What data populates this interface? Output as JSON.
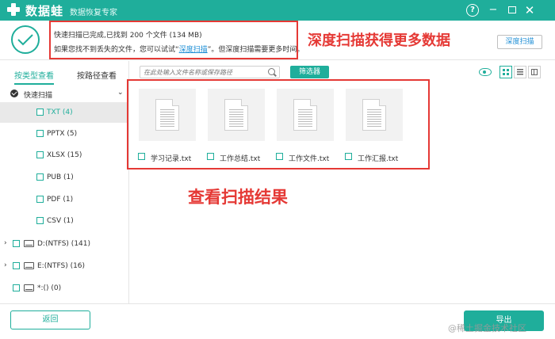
{
  "app": {
    "name": "数据蛙",
    "subtitle": "数据恢复专家",
    "help_label": "?",
    "min_label": "−",
    "close_label": "✕"
  },
  "scan_info": {
    "line1": "快速扫描已完成,已找到 200 个文件 (134 MB)",
    "line2_prefix": "如果您找不到丢失的文件，您可以试试",
    "line2_link": "深度扫描",
    "line2_suffix": "。但深度扫描需要更多时间。",
    "deep_scan_button": "深度扫描"
  },
  "sidebar": {
    "tabs": [
      {
        "label": "按类型查看",
        "active": true
      },
      {
        "label": "按路径查看",
        "active": false
      }
    ],
    "quick_scan_label": "快速扫描",
    "file_types": [
      {
        "label": "TXT (4)",
        "selected": true
      },
      {
        "label": "PPTX (5)",
        "selected": false
      },
      {
        "label": "XLSX (15)",
        "selected": false
      },
      {
        "label": "PUB (1)",
        "selected": false
      },
      {
        "label": "PDF (1)",
        "selected": false
      },
      {
        "label": "CSV (1)",
        "selected": false
      }
    ],
    "drives": [
      {
        "label": "D:(NTFS) (141)"
      },
      {
        "label": "E:(NTFS) (16)"
      },
      {
        "label": "*:() (0)"
      }
    ]
  },
  "toolbar": {
    "search_placeholder": "在此处输入文件名称或保存路径",
    "filter_button": "筛选器"
  },
  "files": [
    {
      "name": "学习记录.txt"
    },
    {
      "name": "工作总结.txt"
    },
    {
      "name": "工作文件.txt"
    },
    {
      "name": "工作汇报.txt"
    }
  ],
  "annotations": {
    "deep_scan_note": "深度扫描获得更多数据",
    "view_results_note": "查看扫描结果",
    "color": "#e53935"
  },
  "footer": {
    "back_button": "返回",
    "export_button": "导出",
    "watermark": "@稀土掘金技术社区"
  },
  "colors": {
    "accent": "#1fae9b",
    "link": "#1f8fd6"
  }
}
